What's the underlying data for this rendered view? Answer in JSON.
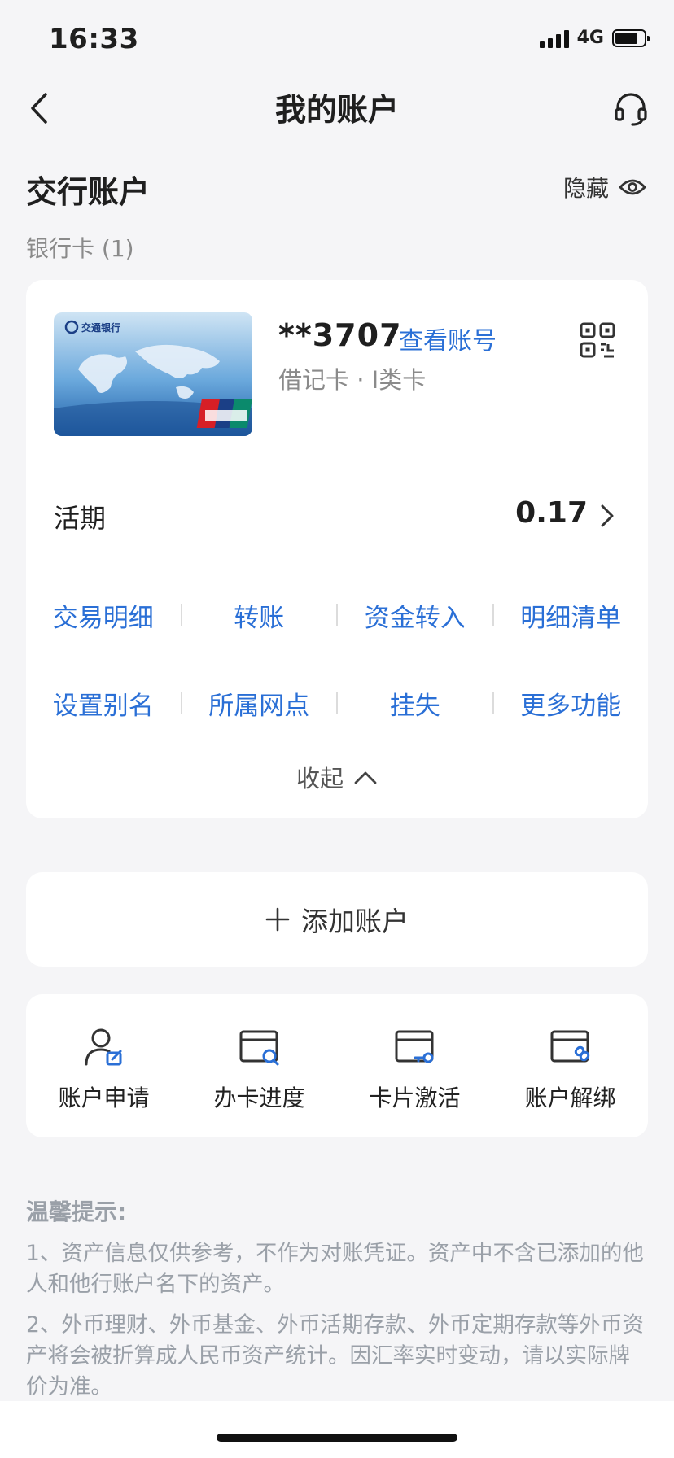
{
  "status": {
    "time": "16:33",
    "network": "4G"
  },
  "nav": {
    "title": "我的账户"
  },
  "account": {
    "section_title": "交行账户",
    "hide_label": "隐藏",
    "card_count_label": "银行卡 (1)",
    "card": {
      "bank_logo_text": "交通银行",
      "number": "**3707",
      "view_number_link": "查看账号",
      "type": "借记卡 · I类卡",
      "balance_label": "活期",
      "balance": "0.17"
    },
    "actions_row1": [
      "交易明细",
      "转账",
      "资金转入",
      "明细清单"
    ],
    "actions_row2": [
      "设置别名",
      "所属网点",
      "挂失",
      "更多功能"
    ],
    "collapse_label": "收起"
  },
  "add_account_label": "添加账户",
  "services": [
    {
      "label": "账户申请",
      "icon": "user-edit-icon"
    },
    {
      "label": "办卡进度",
      "icon": "card-search-icon"
    },
    {
      "label": "卡片激活",
      "icon": "card-key-icon"
    },
    {
      "label": "账户解绑",
      "icon": "card-unlink-icon"
    }
  ],
  "tips": {
    "title": "温馨提示:",
    "items": [
      "1、资产信息仅供参考，不作为对账凭证。资产中不含已添加的他人和他行账户名下的资产。",
      "2、外币理财、外币基金、外币活期存款、外币定期存款等外币资产将会被折算成人民币资产统计。因汇率实时变动，请以实际牌价为准。"
    ]
  },
  "colors": {
    "link": "#2a6fd6",
    "muted": "#9aa0a8",
    "background": "#f5f5f7"
  }
}
